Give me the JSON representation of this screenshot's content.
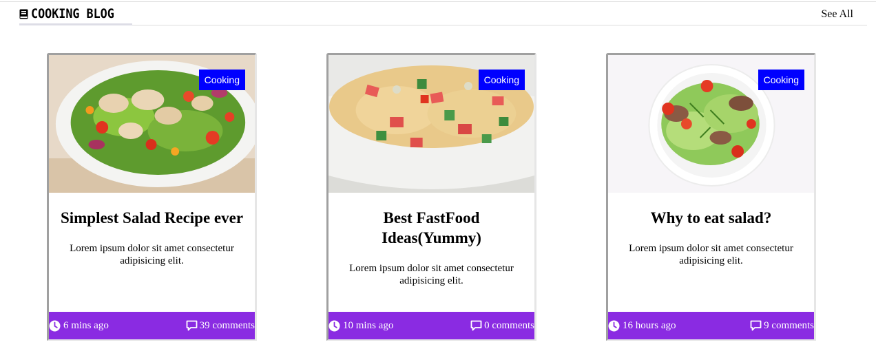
{
  "header": {
    "brand": "COOKING BLOG",
    "brand_icon": "book-icon",
    "see_all": "See All"
  },
  "colors": {
    "tag_bg": "#0000ff",
    "footer_bg": "#8a2be2"
  },
  "cards": [
    {
      "tag": "Cooking",
      "image": "salad-chicken-bowl",
      "title": "Simplest Salad Recipe ever",
      "description": "Lorem ipsum dolor sit amet consectetur adipisicing elit.",
      "time": "6 mins ago",
      "comments": "39 comments"
    },
    {
      "tag": "Cooking",
      "image": "pasta-salad-bowl",
      "title": "Best FastFood Ideas(Yummy)",
      "description": "Lorem ipsum dolor sit amet consectetur adipisicing elit.",
      "time": "10 mins ago",
      "comments": "0 comments"
    },
    {
      "tag": "Cooking",
      "image": "green-salad-plate",
      "title": "Why to eat salad?",
      "description": "Lorem ipsum dolor sit amet consectetur adipisicing elit.",
      "time": "16 hours ago",
      "comments": "9 comments"
    }
  ]
}
